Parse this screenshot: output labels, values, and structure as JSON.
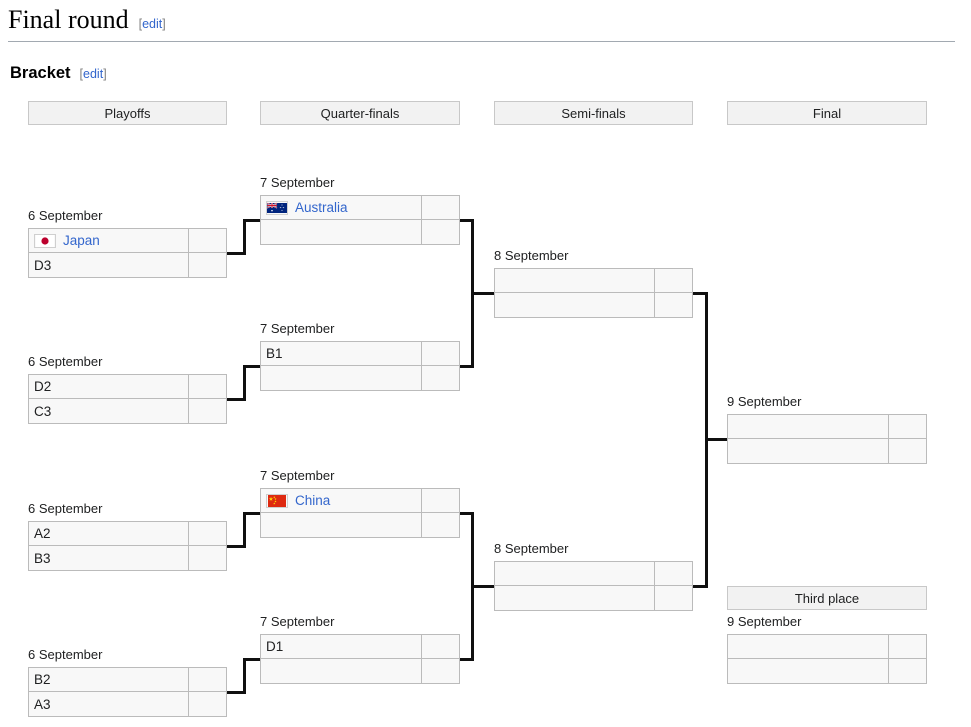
{
  "page": {
    "section_title": "Final round",
    "subsection_title": "Bracket",
    "edit_label": "edit",
    "bracket_open": "[",
    "bracket_close": "]"
  },
  "rounds": [
    {
      "label": "Playoffs"
    },
    {
      "label": "Quarter-finals"
    },
    {
      "label": "Semi-finals"
    },
    {
      "label": "Final"
    }
  ],
  "third_place_header": "Third place",
  "colors": {
    "link": "#3366cc",
    "box_fill": "#f8f8f8",
    "box_border": "#bbbbbb",
    "header_fill": "#f2f2f2",
    "header_border": "#c8c8c8",
    "connector": "#101010",
    "rule": "#a2a9b1"
  },
  "playoffs": [
    {
      "date": "6 September",
      "team1": {
        "name": "Japan",
        "flag": "japan-flag",
        "is_link": true,
        "score": ""
      },
      "team2": {
        "name": "D3",
        "flag": "",
        "is_link": false,
        "score": ""
      }
    },
    {
      "date": "6 September",
      "team1": {
        "name": "D2",
        "flag": "",
        "is_link": false,
        "score": ""
      },
      "team2": {
        "name": "C3",
        "flag": "",
        "is_link": false,
        "score": ""
      }
    },
    {
      "date": "6 September",
      "team1": {
        "name": "A2",
        "flag": "",
        "is_link": false,
        "score": ""
      },
      "team2": {
        "name": "B3",
        "flag": "",
        "is_link": false,
        "score": ""
      }
    },
    {
      "date": "6 September",
      "team1": {
        "name": "B2",
        "flag": "",
        "is_link": false,
        "score": ""
      },
      "team2": {
        "name": "A3",
        "flag": "",
        "is_link": false,
        "score": ""
      }
    }
  ],
  "quarterfinals": [
    {
      "date": "7 September",
      "team1": {
        "name": "Australia",
        "flag": "australia-flag",
        "is_link": true,
        "score": ""
      },
      "team2": {
        "name": "",
        "flag": "",
        "is_link": false,
        "score": ""
      }
    },
    {
      "date": "7 September",
      "team1": {
        "name": "B1",
        "flag": "",
        "is_link": false,
        "score": ""
      },
      "team2": {
        "name": "",
        "flag": "",
        "is_link": false,
        "score": ""
      }
    },
    {
      "date": "7 September",
      "team1": {
        "name": "China",
        "flag": "china-flag",
        "is_link": true,
        "score": ""
      },
      "team2": {
        "name": "",
        "flag": "",
        "is_link": false,
        "score": ""
      }
    },
    {
      "date": "7 September",
      "team1": {
        "name": "D1",
        "flag": "",
        "is_link": false,
        "score": ""
      },
      "team2": {
        "name": "",
        "flag": "",
        "is_link": false,
        "score": ""
      }
    }
  ],
  "semifinals": [
    {
      "date": "8 September",
      "team1": {
        "name": "",
        "flag": "",
        "is_link": false,
        "score": ""
      },
      "team2": {
        "name": "",
        "flag": "",
        "is_link": false,
        "score": ""
      }
    },
    {
      "date": "8 September",
      "team1": {
        "name": "",
        "flag": "",
        "is_link": false,
        "score": ""
      },
      "team2": {
        "name": "",
        "flag": "",
        "is_link": false,
        "score": ""
      }
    }
  ],
  "final": {
    "date": "9 September",
    "team1": {
      "name": "",
      "flag": "",
      "is_link": false,
      "score": ""
    },
    "team2": {
      "name": "",
      "flag": "",
      "is_link": false,
      "score": ""
    }
  },
  "third_place": {
    "date": "9 September",
    "team1": {
      "name": "",
      "flag": "",
      "is_link": false,
      "score": ""
    },
    "team2": {
      "name": "",
      "flag": "",
      "is_link": false,
      "score": ""
    }
  }
}
